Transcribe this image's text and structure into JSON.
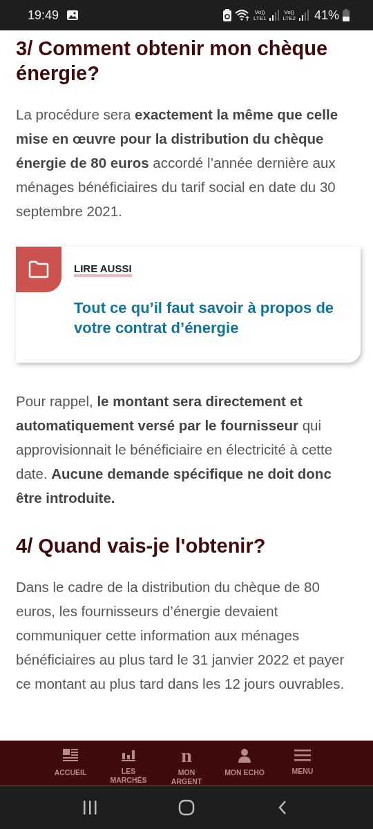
{
  "status_bar": {
    "time": "19:49",
    "battery": "41%",
    "sim_1": "LTE1",
    "sim_2": "LTE2",
    "volte_1": "Vo))",
    "volte_2": "Vo))"
  },
  "article": [
    {
      "kind": "heading",
      "text": "3/ Comment obtenir mon chèque énergie?"
    },
    {
      "kind": "paragraph",
      "text": "La procédure sera **exactement la même que celle mise en œuvre pour la distribution du chèque énergie de 80 euros** accordé l’année dernière aux ménages bénéficiaires du tarif social en date du 30 septembre 2021."
    },
    {
      "kind": "related",
      "label": "LIRE AUSSI",
      "title": "Tout ce qu’il faut savoir à propos de votre contrat d’énergie"
    },
    {
      "kind": "paragraph",
      "text": "Pour rappel, **le montant sera directement et automatiquement versé par le fournisseur** qui approvisionnait le bénéficiaire en électricité à cette date. **Aucune demande spécifique ne doit donc être introduite.**"
    },
    {
      "kind": "heading",
      "text": "4/ Quand vais-je l'obtenir?"
    },
    {
      "kind": "paragraph",
      "text": "Dans le cadre de la distribution du chèque de 80 euros, les fournisseurs d’énergie devaient communiquer cette information aux ménages bénéficiaires au plus tard le 31 janvier 2022 et payer ce montant au plus tard dans les 12 jours ouvrables."
    }
  ],
  "bottom_nav": [
    {
      "kind": "home",
      "label": "ACCUEIL"
    },
    {
      "kind": "markets",
      "label": "LES MARCHÉS"
    },
    {
      "kind": "money",
      "label": "MON ARGENT",
      "icon_text": "n"
    },
    {
      "kind": "account",
      "label": "MON ECHO"
    },
    {
      "kind": "menu",
      "label": "MENU"
    }
  ]
}
